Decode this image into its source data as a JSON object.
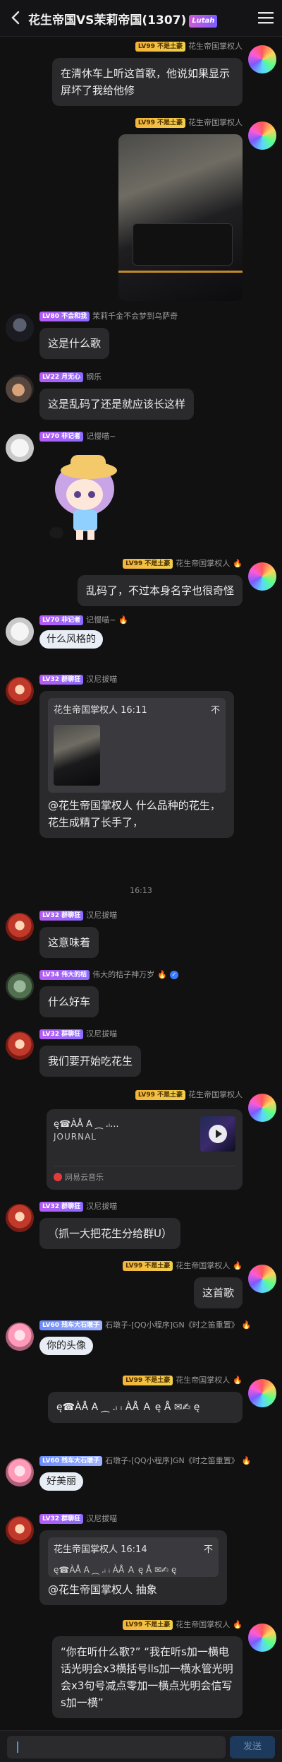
{
  "header": {
    "title": "花生帝国VS茉莉帝国(1307)",
    "tag": "Lutah"
  },
  "messages": [
    {
      "name": "花生帝国掌权人",
      "lv": "LV99 不是土豪",
      "text": "在清休车上听这首歌，他说如果显示屏坏了我给他修"
    },
    {
      "name": "花生帝国掌权人",
      "lv": "LV99 不是土豪"
    },
    {
      "name": "茉莉千金不会梦到乌萨奇",
      "lv": "LV80 不会和我",
      "text": "这是什么歌"
    },
    {
      "name": "钢乐",
      "lv": "LV22 月无心",
      "text": "这是乱码了还是就应该长这样"
    },
    {
      "name": "记慢喵~",
      "lv": "LV70 非记者"
    },
    {
      "name": "花生帝国掌权人",
      "lv": "LV99 不是土豪",
      "text": "乱码了，不过本身名字也很奇怪"
    },
    {
      "name": "记慢喵~",
      "lv": "LV70 非记者",
      "text": "什么风格的"
    },
    {
      "name": "汉尼拔喵",
      "lv": "LV32 群聊狂",
      "reply_head": "花生帝国掌权人 16:11",
      "text": "@花生帝国掌权人 什么品种的花生，花生成精了长手了，"
    },
    {
      "name": "汉尼拔喵",
      "lv": "LV32 群聊狂",
      "text": "这意味着"
    },
    {
      "name": "伟大的桔子神万岁",
      "lv": "LV34 伟大的桔",
      "text": "什么好车"
    },
    {
      "name": "汉尼拔喵",
      "lv": "LV32 群聊狂",
      "text": "我们要开始吃花生"
    },
    {
      "name": "花生帝国掌权人",
      "lv": "LV99 不是土豪",
      "music_title": "ę☎ÀÅ A ⁔ .ᵢ...",
      "music_sub": "JOURNAL",
      "music_src": "网易云音乐"
    },
    {
      "name": "汉尼拔喵",
      "lv": "LV32 群聊狂",
      "text": "（抓一大把花生分给群U）"
    },
    {
      "name": "花生帝国掌权人",
      "lv": "LV99 不是土豪",
      "text": "这首歌"
    },
    {
      "name": "石墩子-[QQ小程序]GN《时之笛重置》",
      "lv": "LV60 残车大石墩子",
      "text": "你的头像"
    },
    {
      "name": "花生帝国掌权人",
      "lv": "LV99 不是土豪",
      "text": "ę☎ÀÅ A ⁔ .ᵢ ᵢ ÀÅ Ａ ę Å ✉✍ ę"
    },
    {
      "name": "石墩子-[QQ小程序]GN《时之笛重置》",
      "lv": "LV60 残车大石墩子",
      "text": "好美丽"
    },
    {
      "name": "汉尼拔喵",
      "lv": "LV32 群聊狂",
      "reply_head": "花生帝国掌权人 16:14",
      "reply_text": "ę☎ÀÅ A ⁔ .ᵢ ᵢ ÀÅ Ａ ę Å ✉✍ ę",
      "text": "@花生帝国掌权人 抽象"
    },
    {
      "name": "花生帝国掌权人",
      "lv": "LV99 不是土豪",
      "text": "“你在听什么歌?” “我在听s加一横电话光明会x3横括号lls加一横水管光明会x3句号减点零加一横点光明会信写s加一横”"
    }
  ],
  "timestamp": "16:13",
  "reply_marker": "不",
  "input": {
    "send_label": "发送"
  }
}
